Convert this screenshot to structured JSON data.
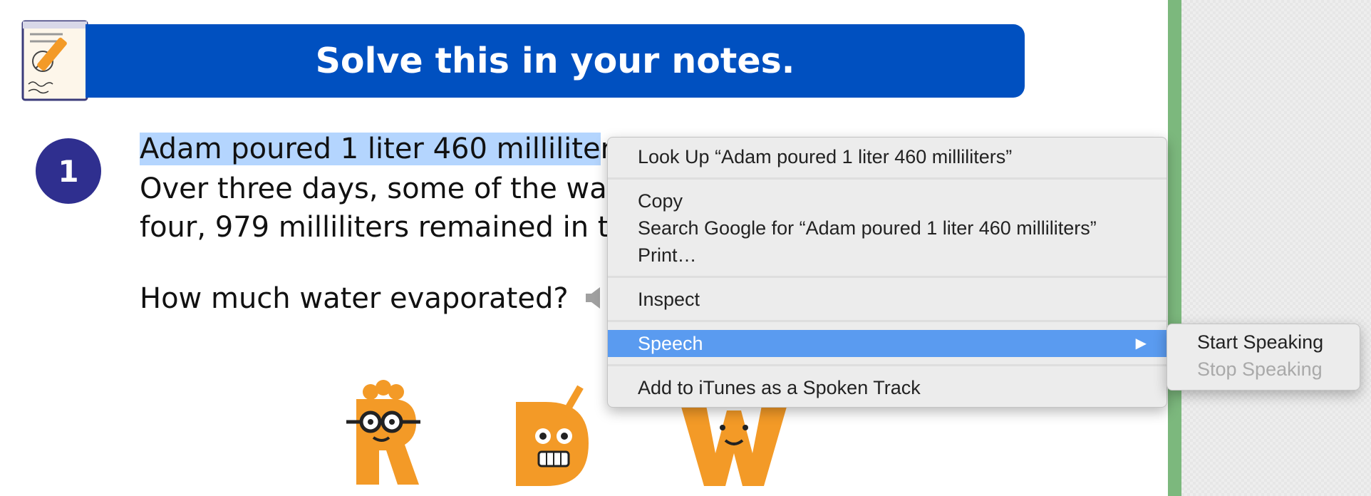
{
  "header": {
    "title": "Solve this in your notes."
  },
  "question": {
    "number": "1",
    "line1_selected": "Adam poured 1 liter 460 millilite",
    "line1_rest": "r",
    "line2": "Over three days, some of the wa",
    "line3": "four, 979 milliliters remained in t",
    "prompt": "How much water evaporated?"
  },
  "context_menu": {
    "look_up": "Look Up “Adam poured 1 liter 460 milliliters”",
    "copy": "Copy",
    "search_google": "Search Google for “Adam poured 1 liter 460 milliliters”",
    "print": "Print…",
    "inspect": "Inspect",
    "speech": "Speech",
    "speech_arrow": "▶",
    "add_itunes": "Add to iTunes as a Spoken Track"
  },
  "speech_submenu": {
    "start": "Start Speaking",
    "stop": "Stop Speaking"
  },
  "colors": {
    "banner": "#0050c0",
    "selection": "#b4d5fe",
    "menu_highlight": "#5a9bf0",
    "mascot_orange": "#f39a27",
    "side_green": "#7cb87d"
  }
}
